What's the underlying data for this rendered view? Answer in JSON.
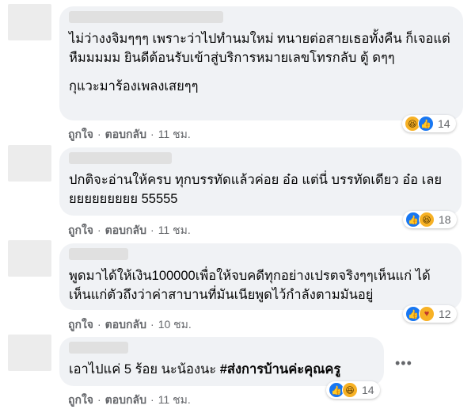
{
  "comments": [
    {
      "lines": [
        "ไม่ว่างงจิมๆๆๆ เพราะว่าไปทำนมใหม่ ทนายต่อสายเธอทั้งคืน ก็เจอแต่ หืมมมมม ยินดีต้อนรับเข้าสู่บริการหมายเลขโทรกลับ ตู้ ดๆๆ"
      ],
      "second_para": "กุแวะมาร้องเพลงเสยๆๆ",
      "like_label": "ถูกใจ",
      "reply_label": "ตอบกลับ",
      "time": "11 ชม.",
      "reaction_icons": [
        "haha-icon",
        "like-icon"
      ],
      "reaction_count": "14"
    },
    {
      "lines": [
        "ปกติจะอ่านให้ครบ ทุกบรรทัดแล้วค่อย อ๋อ แต่นี่ บรรทัดเดียว อ๋อ เลยยยยยยยยยย 55555"
      ],
      "like_label": "ถูกใจ",
      "reply_label": "ตอบกลับ",
      "time": "11 ชม.",
      "reaction_icons": [
        "like-icon",
        "haha-icon"
      ],
      "reaction_count": "18"
    },
    {
      "lines": [
        "พูดมาได้ให้เงิน100000เพื่อให้จบคดีทุกอย่างเปรตจริงๆๆเห็นแก่ ได้เห็นแก่ตัวถึงว่าค่าสาบานที่มันเนียพูดไว้กำลังตามมันอยู่"
      ],
      "like_label": "ถูกใจ",
      "reply_label": "ตอบกลับ",
      "time": "10 ชม.",
      "reaction_icons": [
        "like-icon",
        "care-icon"
      ],
      "reaction_count": "12"
    },
    {
      "text_plain": "เอาไปแค่ 5 ร้อย นะน้องนะ ",
      "text_hashtag": "#ส่งการบ้านค่ะคุณครู",
      "like_label": "ถูกใจ",
      "reply_label": "ตอบกลับ",
      "time": "11 ชม.",
      "reaction_icons": [
        "like-icon",
        "haha-icon"
      ],
      "reaction_count": "14",
      "more_label": "•••"
    }
  ],
  "separator": "·"
}
